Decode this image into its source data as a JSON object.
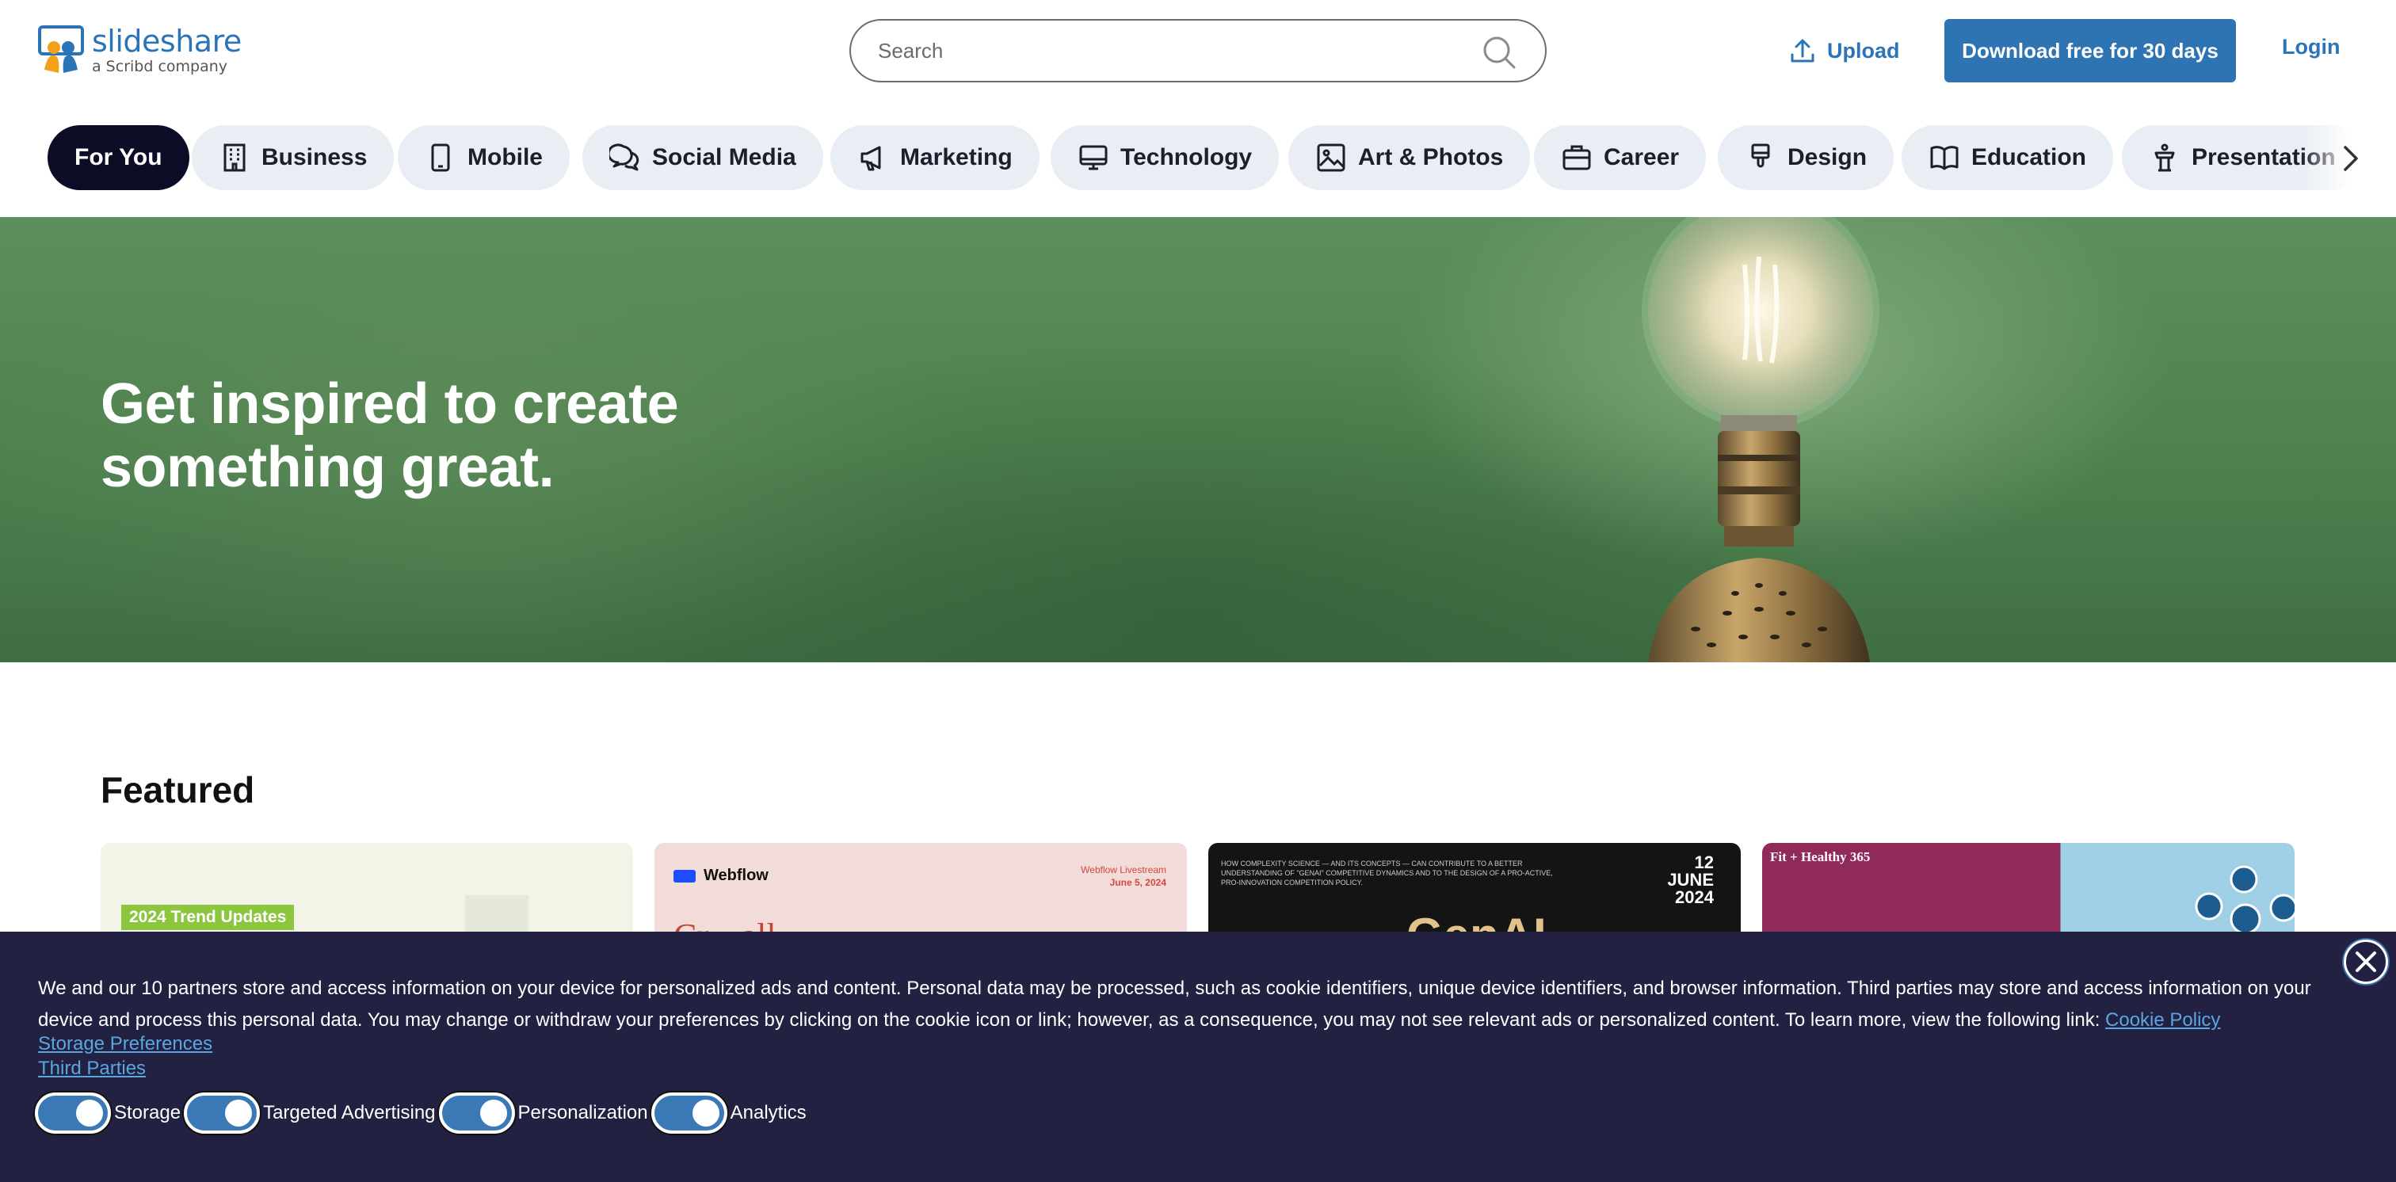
{
  "header": {
    "logo": {
      "name": "slideshare",
      "tagline": "a Scribd company"
    },
    "search": {
      "placeholder": "Search",
      "value": ""
    },
    "upload_label": "Upload",
    "download_label": "Download free for 30 days",
    "login_label": "Login"
  },
  "categories": [
    {
      "label": "For You",
      "icon": "",
      "active": true
    },
    {
      "label": "Business",
      "icon": "building-icon",
      "active": false
    },
    {
      "label": "Mobile",
      "icon": "mobile-icon",
      "active": false
    },
    {
      "label": "Social Media",
      "icon": "chat-bubbles-icon",
      "active": false
    },
    {
      "label": "Marketing",
      "icon": "megaphone-icon",
      "active": false
    },
    {
      "label": "Technology",
      "icon": "monitor-icon",
      "active": false
    },
    {
      "label": "Art & Photos",
      "icon": "image-icon",
      "active": false
    },
    {
      "label": "Career",
      "icon": "briefcase-icon",
      "active": false
    },
    {
      "label": "Design",
      "icon": "paintbrush-icon",
      "active": false
    },
    {
      "label": "Education",
      "icon": "open-book-icon",
      "active": false
    },
    {
      "label": "Presentation",
      "icon": "podium-icon",
      "active": false
    }
  ],
  "hero": {
    "line1": "Get inspired to create",
    "line2": "something great."
  },
  "featured": {
    "title": "Featured",
    "cards": [
      {
        "tag": "2024 Trend Updates"
      },
      {
        "brand": "Webflow",
        "date_label": "Webflow Livestream",
        "date": "June 5, 2024",
        "headline": "Cr... all..."
      },
      {
        "blurb": "HOW COMPLEXITY SCIENCE — AND ITS CONCEPTS — CAN CONTRIBUTE TO A BETTER UNDERSTANDING OF \"GENAI\" COMPETITIVE DYNAMICS AND TO THE DESIGN OF A PRO-ACTIVE, PRO-INNOVATION COMPETITION POLICY.",
        "day": "12",
        "month": "JUNE",
        "year": "2024",
        "headline": "GenAI"
      },
      {
        "title": "Fit + Healthy 365"
      }
    ]
  },
  "cookie": {
    "text": "We and our 10 partners store and access information on your device for personalized ads and content. Personal data may be processed, such as cookie identifiers, unique device identifiers, and browser information. Third parties may store and access information on your device and process this personal data. You may change or withdraw your preferences by clicking on the cookie icon or link; however, as a consequence, you may not see relevant ads or personalized content. To learn more, view the following link:",
    "policy_link": "Cookie Policy",
    "storage_link": "Storage Preferences",
    "third_parties_link": "Third Parties",
    "toggles": [
      {
        "label": "Storage",
        "on": true
      },
      {
        "label": "Targeted Advertising",
        "on": true
      },
      {
        "label": "Personalization",
        "on": true
      },
      {
        "label": "Analytics",
        "on": true
      }
    ]
  },
  "colors": {
    "brand_blue": "#2e74b3",
    "active_pill": "#0c0c26",
    "pill_bg": "#e8eef4",
    "banner_bg": "#222141",
    "link": "#5aa7e0"
  }
}
